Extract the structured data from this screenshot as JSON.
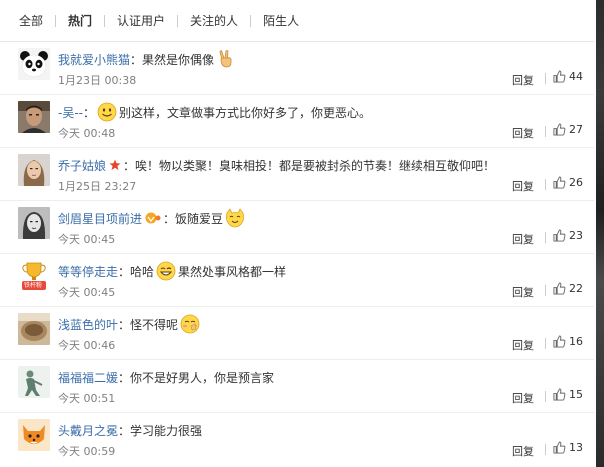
{
  "filter_tabs": [
    "全部",
    "热门",
    "认证用户",
    "关注的人",
    "陌生人"
  ],
  "active_tab": "热门",
  "comments": [
    {
      "username": "我就爱小熊猫",
      "colon": "：",
      "text": "果然是你偶像",
      "emoji_after": "victory-hand-emoji",
      "time": "1月23日 00:38",
      "reply": "回复",
      "likes": "44",
      "avatar": "panda-avatar"
    },
    {
      "username": "-吴--",
      "colon": "：",
      "emoji_before": "smile-emoji",
      "text": "别这样，文章做事方式比你好多了，你更恶心。",
      "time": "今天 00:48",
      "reply": "回复",
      "likes": "27",
      "avatar": "man-avatar"
    },
    {
      "username": "乔子姑娘",
      "badge": "star-icon",
      "colon": "：",
      "text": "唉！物以类聚！臭味相投！都是要被封杀的节奏！继续相互敬仰吧！",
      "time": "1月25日 23:27",
      "reply": "回复",
      "likes": "26",
      "avatar": "woman-avatar"
    },
    {
      "username": "剑眉星目项前进",
      "badge": "vip-icon",
      "colon": "：",
      "text": "饭随爱豆",
      "emoji_after": "cat-emoji",
      "time": "今天 00:45",
      "reply": "回复",
      "likes": "23",
      "avatar": "bw-portrait-avatar"
    },
    {
      "username": "等等停走走",
      "colon": "：",
      "text": "哈哈",
      "emoji_mid": "grin-emoji",
      "text2": "果然处事风格都一样",
      "time": "今天 00:45",
      "reply": "回复",
      "likes": "22",
      "avatar": "trophy-avatar",
      "avatar_label": "铁杆粉"
    },
    {
      "username": "浅蓝色的叶",
      "colon": "：",
      "text": "怪不得呢",
      "emoji_after": "shy-emoji",
      "time": "今天 00:46",
      "reply": "回复",
      "likes": "16",
      "avatar": "food-avatar"
    },
    {
      "username": "福福福二媛",
      "colon": "：",
      "text": "你不是好男人，你是预言家",
      "time": "今天 00:51",
      "reply": "回复",
      "likes": "15",
      "avatar": "figure-avatar"
    },
    {
      "username": "头戴月之冕",
      "colon": "：",
      "text": "学习能力很强",
      "time": "今天 00:59",
      "reply": "回复",
      "likes": "13",
      "avatar": "fox-avatar"
    }
  ],
  "colors": {
    "username": "#eb7350",
    "username_blue": "#3b6ea8",
    "time": "#808080",
    "text": "#333333"
  }
}
